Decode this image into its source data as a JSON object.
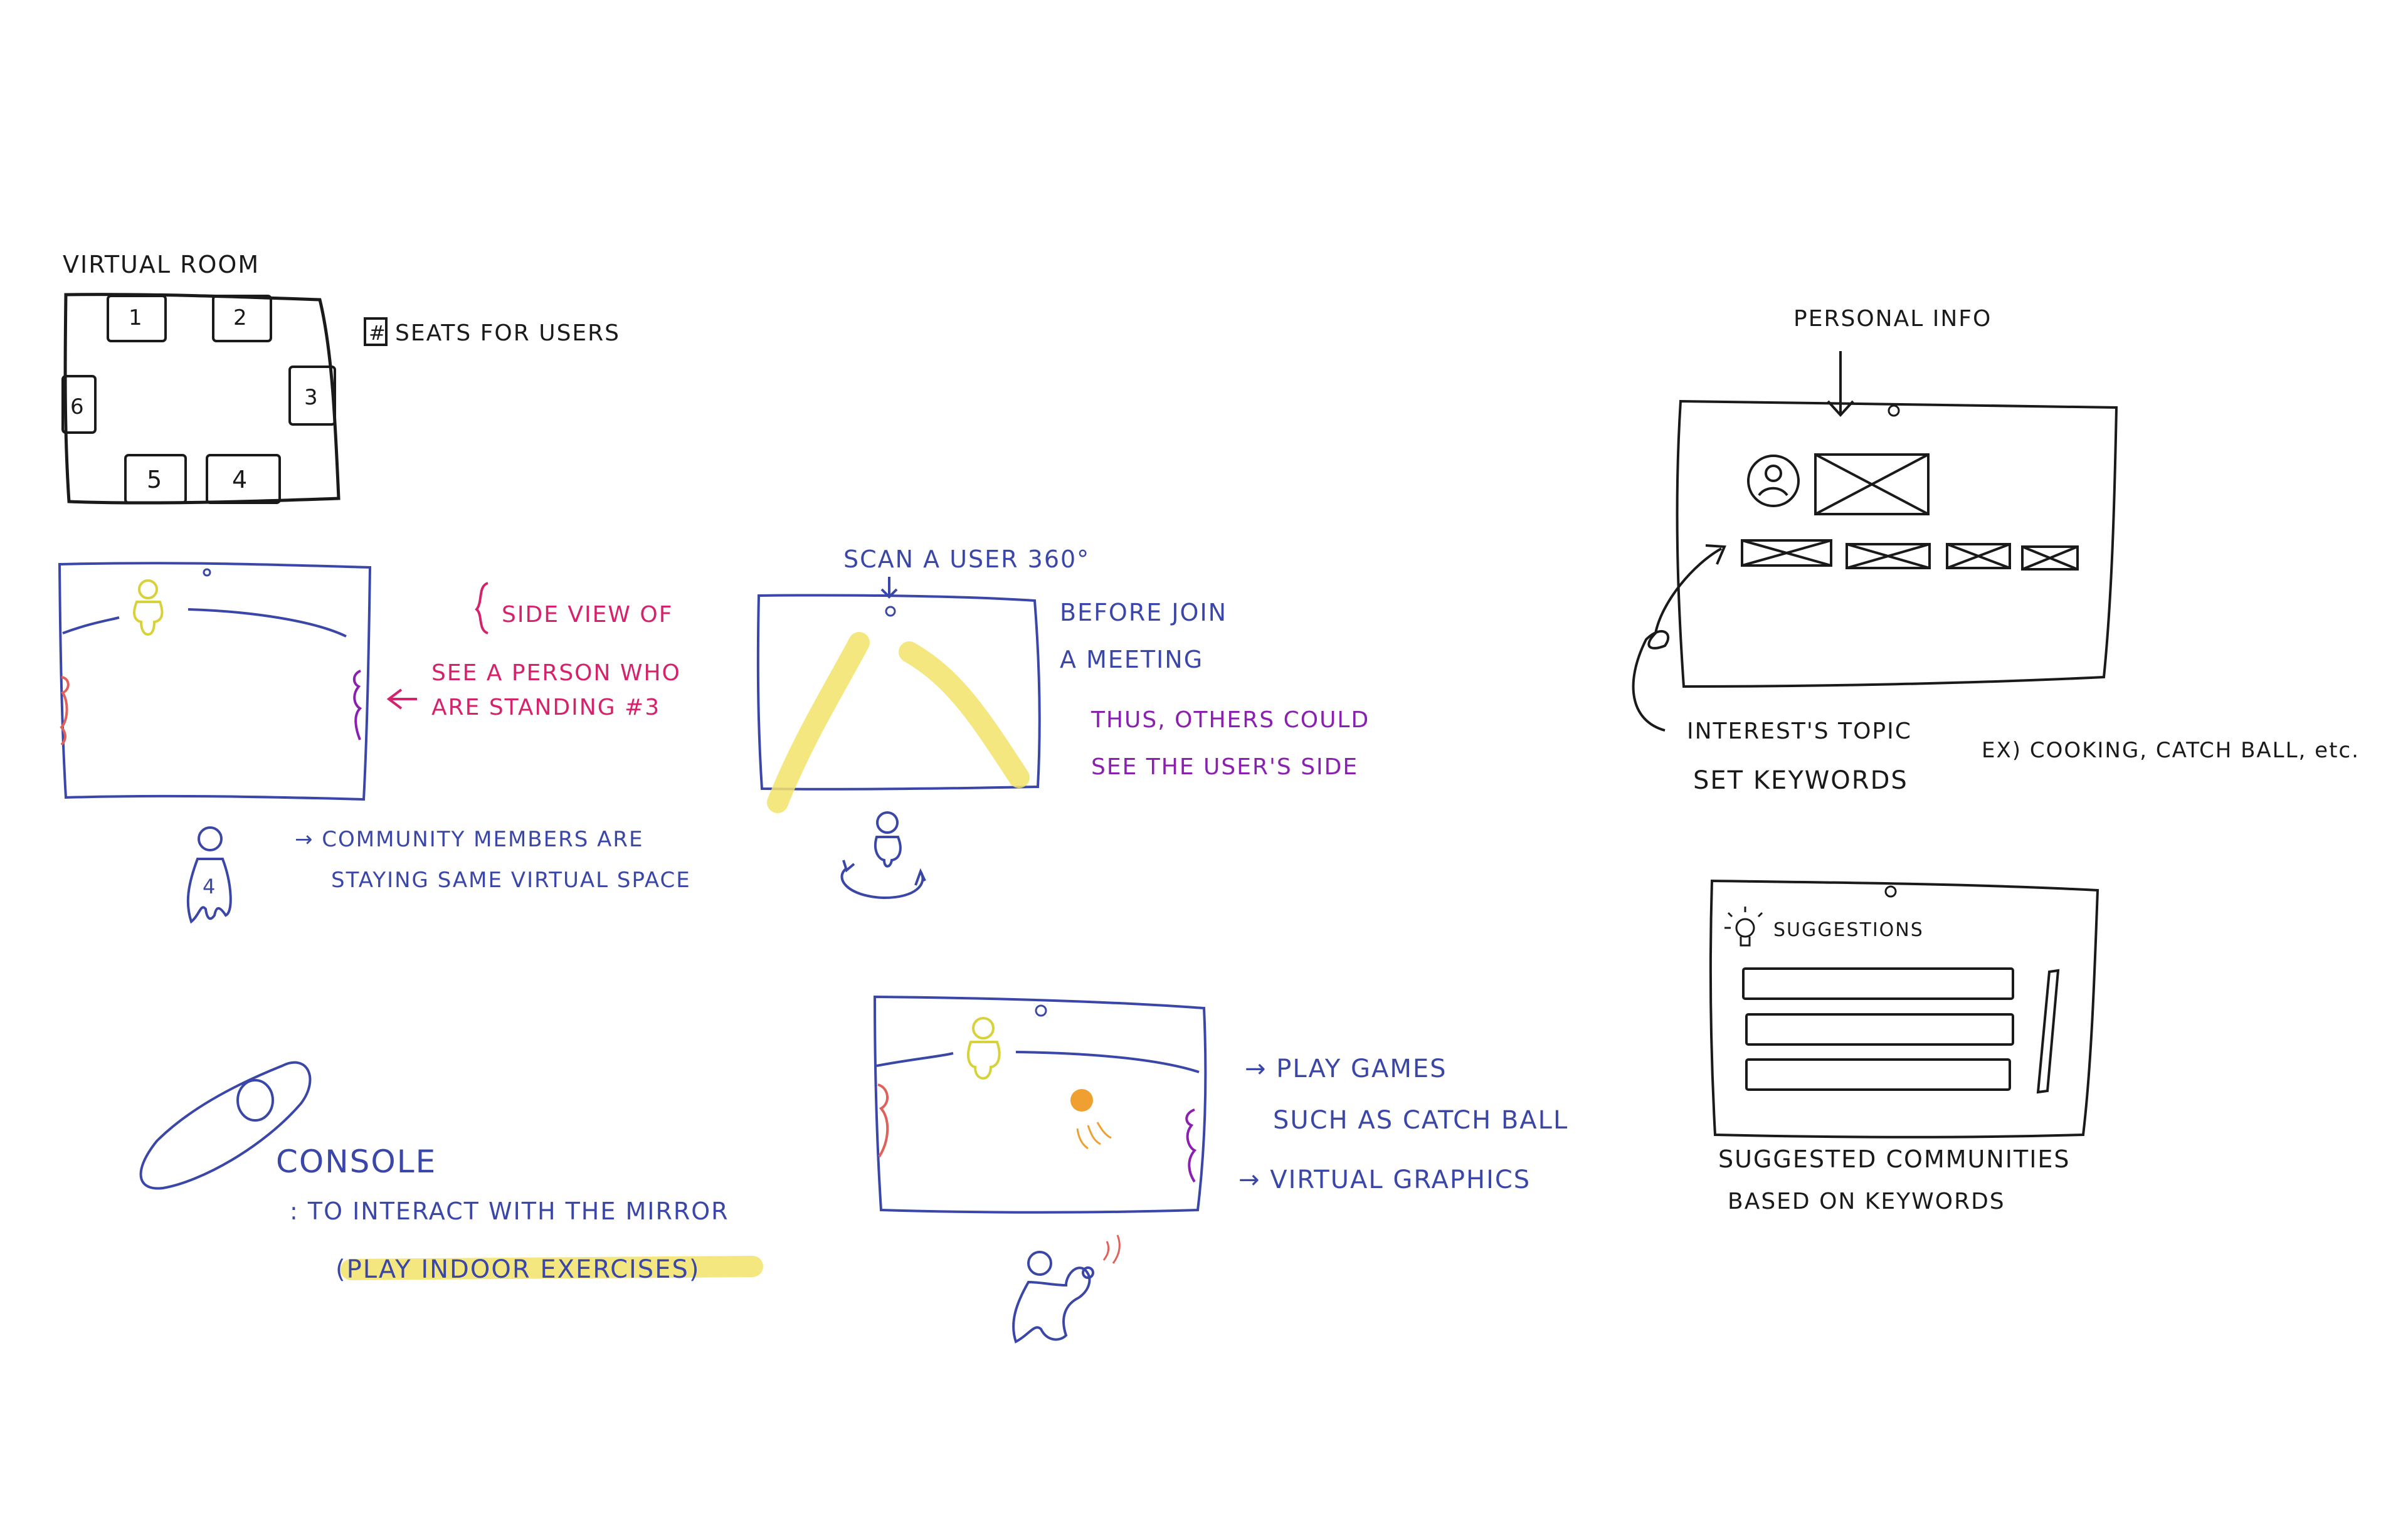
{
  "virtual_room": {
    "title": "VIRTUAL ROOM",
    "seat_note": "SEATS FOR USERS",
    "seat_note_symbol": "#",
    "seats": [
      "1",
      "2",
      "3",
      "4",
      "5",
      "6"
    ]
  },
  "side_view": {
    "note_line1": "SIDE VIEW OF",
    "note_line2": "SEE A PERSON WHO",
    "note_line3": "ARE STANDING #3",
    "user_number": "4",
    "community_line1": "→ COMMUNITY MEMBERS ARE",
    "community_line2": "STAYING SAME VIRTUAL SPACE"
  },
  "scan": {
    "title": "SCAN A USER 360°",
    "before_line1": "BEFORE JOIN",
    "before_line2": "A MEETING",
    "thus_line1": "THUS, OTHERS COULD",
    "thus_line2": "SEE THE USER'S SIDE"
  },
  "profile": {
    "personal_info": "PERSONAL INFO",
    "interest_topic": "INTEREST'S TOPIC",
    "set_keywords": "SET KEYWORDS",
    "examples": "EX) COOKING, CATCH BALL, etc."
  },
  "suggestions": {
    "header": "SUGGESTIONS",
    "caption_line1": "SUGGESTED COMMUNITIES",
    "caption_line2": "BASED ON KEYWORDS"
  },
  "console": {
    "title": "CONSOLE",
    "line1": ": TO INTERACT WITH THE MIRROR",
    "line2": "(PLAY INDOOR EXERCISES)"
  },
  "games": {
    "line1": "→ PLAY GAMES",
    "line2": "SUCH AS CATCH BALL",
    "line3": "→ VIRTUAL GRAPHICS"
  },
  "colors": {
    "black": "#1a1a1a",
    "blue": "#3b47a8",
    "pink": "#d6226b",
    "purple": "#8a1fb0",
    "yellow_highlight": "#f3e36a",
    "orange": "#f0a030",
    "red_figure": "#e0605a"
  }
}
